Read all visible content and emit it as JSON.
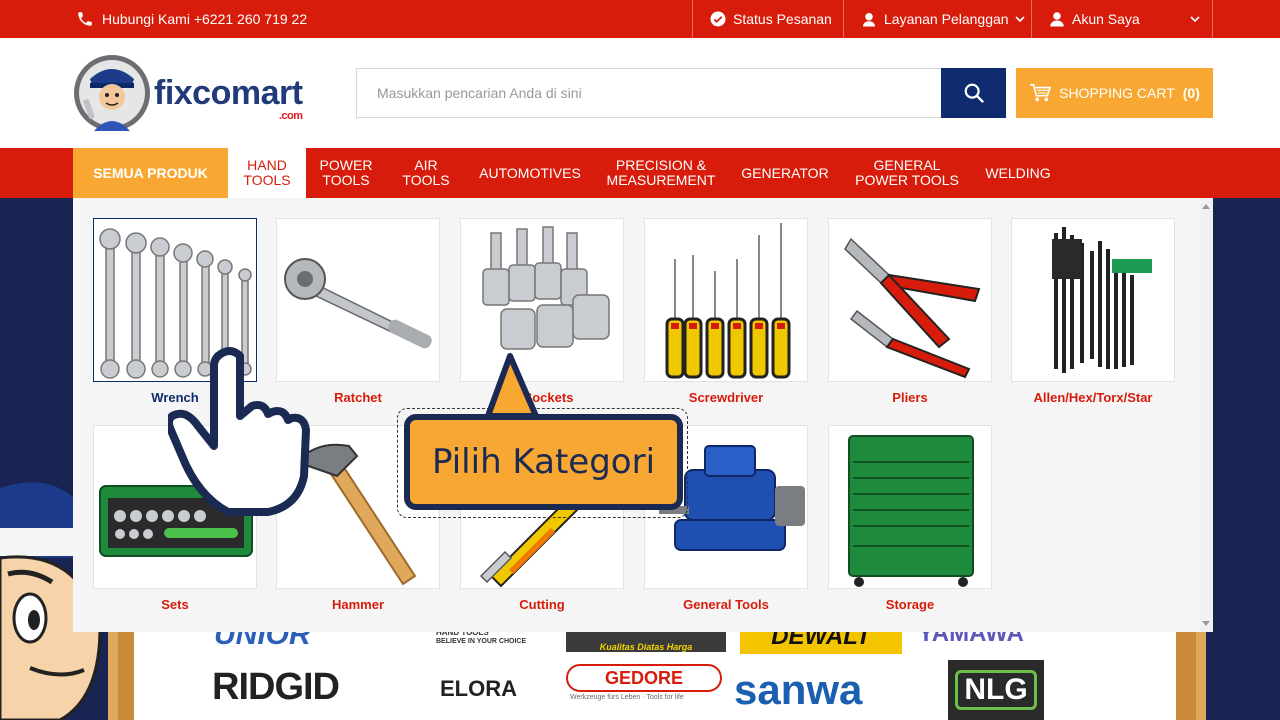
{
  "topbar": {
    "phone_label": "Hubungi Kami +6221 260 719 22",
    "order_status": "Status Pesanan",
    "customer_service": "Layanan Pelanggan",
    "account": "Akun Saya"
  },
  "header": {
    "logo_text_main": "fixcomart",
    "logo_text_sub": ".com",
    "search_placeholder": "Masukkan pencarian Anda di sini",
    "cart_label": "SHOPPING CART",
    "cart_count": "(0)"
  },
  "nav": {
    "all_products": "SEMUA PRODUK",
    "items": [
      {
        "label": "HAND\nTOOLS",
        "active": true
      },
      {
        "label": "POWER\nTOOLS"
      },
      {
        "label": "AIR\nTOOLS"
      },
      {
        "label": "AUTOMOTIVES"
      },
      {
        "label": "PRECISION &\nMEASUREMENT"
      },
      {
        "label": "GENERATOR"
      },
      {
        "label": "GENERAL\nPOWER TOOLS"
      },
      {
        "label": "WELDING"
      }
    ]
  },
  "categories": [
    {
      "label": "Wrench",
      "selected": true
    },
    {
      "label": "Ratchet"
    },
    {
      "label": "& Sockets"
    },
    {
      "label": "Screwdriver"
    },
    {
      "label": "Pliers"
    },
    {
      "label": "Allen/Hex/Torx/Star"
    },
    {
      "label": "Sets"
    },
    {
      "label": "Hammer"
    },
    {
      "label": "Cutting"
    },
    {
      "label": "General Tools"
    },
    {
      "label": "Storage"
    }
  ],
  "callout": {
    "text": "Pilih Kategori"
  },
  "brands": [
    "UNIOR",
    "HAND TOOLS",
    "BELIEVE IN YOUR CHOICE",
    "Kualitas Diatas Harga",
    "DEWALT",
    "YAMAWA",
    "RIDGID",
    "ELORA",
    "GEDORE",
    "Werkzeuge fürs Leben · Tools for life",
    "sanwa",
    "NLG"
  ],
  "colors": {
    "primary_red": "#d81c0b",
    "accent_orange": "#f8a832",
    "navy": "#0d2b6e"
  }
}
